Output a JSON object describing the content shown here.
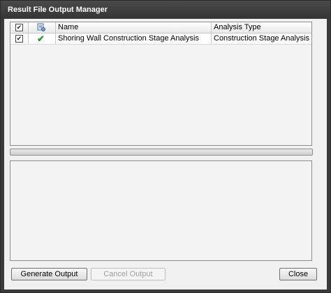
{
  "window": {
    "title": "Result File Output Manager"
  },
  "table": {
    "columns": {
      "name": "Name",
      "analysis_type": "Analysis Type"
    },
    "header_checked": "✔",
    "rows": [
      {
        "checked": "✔",
        "status": "✔",
        "name": "Shoring Wall Construction Stage Analysis",
        "analysis_type": "Construction Stage Analysis"
      }
    ]
  },
  "buttons": {
    "generate": "Generate Output",
    "cancel": "Cancel Output",
    "close": "Close"
  },
  "colors": {
    "status_ok": "#2a9a2a"
  }
}
